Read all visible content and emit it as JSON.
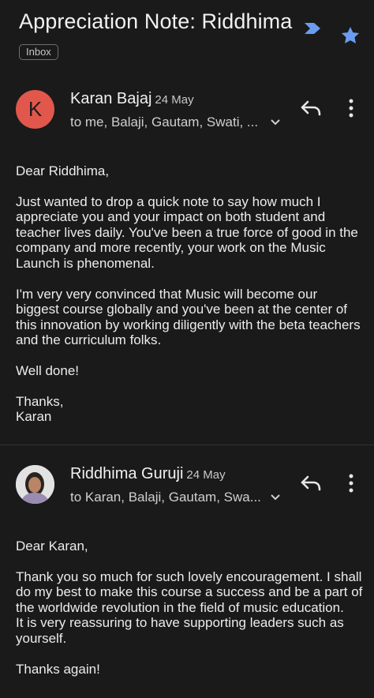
{
  "thread": {
    "subject": "Appreciation Note: Riddhima",
    "label": "Inbox",
    "colors": {
      "important": "#6a9cf1",
      "star": "#6a9cf1",
      "avatar_k": "#e2574c"
    }
  },
  "messages": [
    {
      "avatar_letter": "K",
      "sender": "Karan Bajaj",
      "date": "24 May",
      "recipients": "to me, Balaji, Gautam, Swati, ...",
      "body": [
        "Dear Riddhima,",
        "Just wanted to drop a quick note to say how much I appreciate you and your impact on both student and teacher lives daily. You've been a true force of good in the company and more recently, your work on the Music Launch is phenomenal.",
        "I'm very very convinced that Music will become our biggest course globally and you've been at the center of this innovation by working diligently with the beta teachers and the curriculum folks.",
        "Well done!",
        "Thanks,\nKaran"
      ]
    },
    {
      "sender": "Riddhima Guruji",
      "date": "24 May",
      "recipients": "to Karan, Balaji, Gautam, Swa...",
      "body": [
        "Dear Karan,",
        "Thank you so much for such lovely encouragement. I shall do my best to make this course a success and be a part of the worldwide revolution in the field of music education.\nIt is very reassuring to have supporting leaders such as yourself.",
        "Thanks again!"
      ]
    }
  ],
  "icons": {
    "important": "important-marker-icon",
    "star": "star-icon",
    "reply": "reply-arrow-icon",
    "more": "more-vert-icon",
    "expand": "chevron-down-icon"
  }
}
